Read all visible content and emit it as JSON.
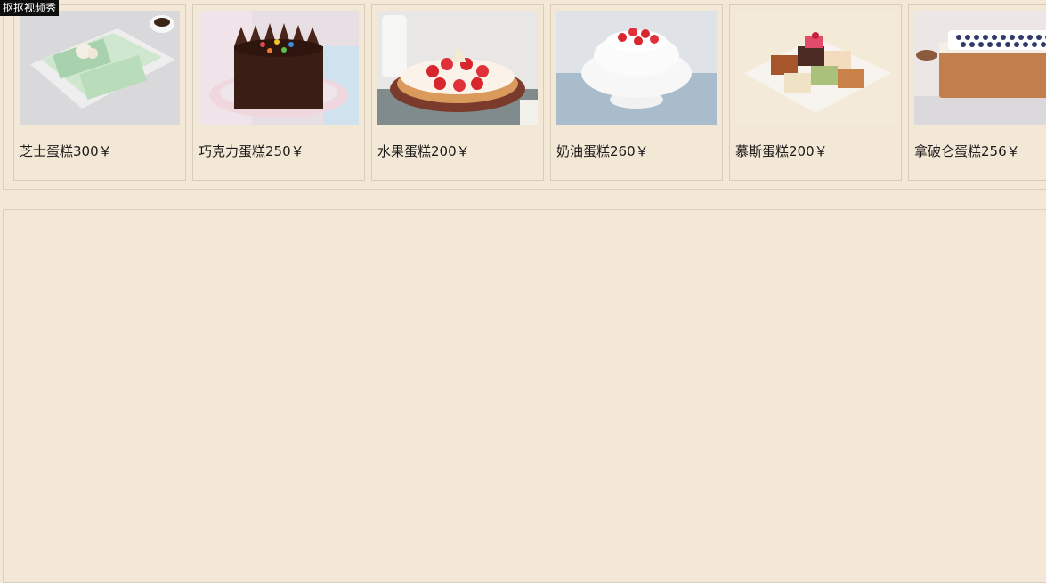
{
  "watermark": "抠抠视频秀",
  "products": [
    {
      "label": "芝士蛋糕300￥",
      "image_icon": "cheese-cake-image"
    },
    {
      "label": "巧克力蛋糕250￥",
      "image_icon": "chocolate-cake-image"
    },
    {
      "label": "水果蛋糕200￥",
      "image_icon": "fruit-cake-image"
    },
    {
      "label": "奶油蛋糕260￥",
      "image_icon": "cream-cake-image"
    },
    {
      "label": "慕斯蛋糕200￥",
      "image_icon": "mousse-cake-image"
    },
    {
      "label": "拿破仑蛋糕256￥",
      "image_icon": "napoleon-cake-image"
    }
  ],
  "colors": {
    "background": "#f3e7d6",
    "border": "#d8ccba",
    "text": "#1a1a1a"
  }
}
